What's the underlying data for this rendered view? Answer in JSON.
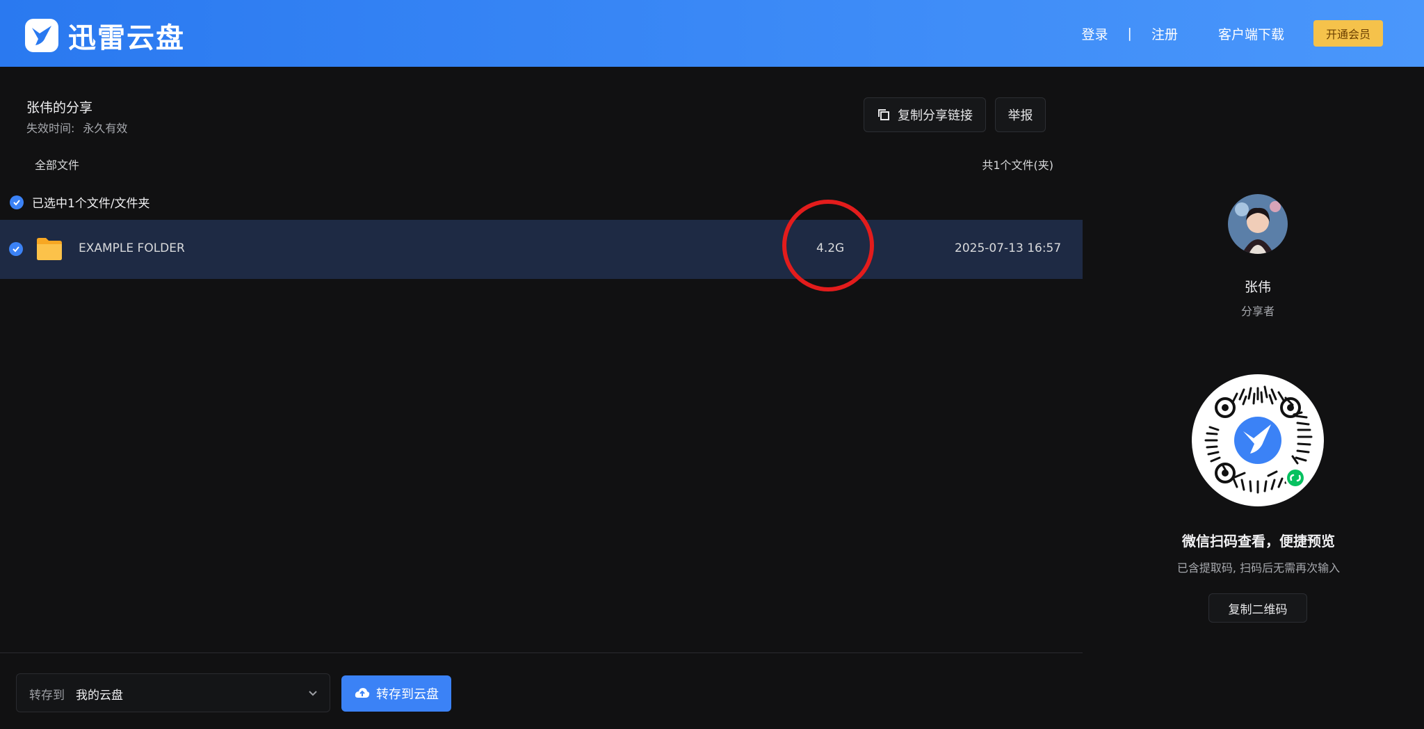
{
  "header": {
    "brand": "迅雷云盘",
    "login": "登录",
    "separator": "|",
    "register": "注册",
    "client_download": "客户端下载",
    "vip": "开通会员"
  },
  "share": {
    "title": "张伟的分享",
    "expire_label": "失效时间:",
    "expire_value": "永久有效",
    "copy_link_button": "复制分享链接",
    "report_button": "举报"
  },
  "file_list": {
    "all_files_label": "全部文件",
    "count_text": "共1个文件(夹)",
    "selected_text": "已选中1个文件/文件夹",
    "rows": [
      {
        "name": "EXAMPLE FOLDER",
        "size": "4.2G",
        "date": "2025-07-13 16:57",
        "selected": true
      }
    ]
  },
  "sharer": {
    "name": "张伟",
    "role": "分享者"
  },
  "qr": {
    "title": "微信扫码查看，便捷预览",
    "subtitle": "已含提取码, 扫码后无需再次输入",
    "copy_button": "复制二维码"
  },
  "bottom": {
    "save_to_label": "转存到",
    "save_to_value": "我的云盘",
    "save_button": "转存到云盘"
  },
  "colors": {
    "header_blue": "#3d8bf7",
    "accent_blue": "#3b82f6",
    "vip_gold": "#f5c24b",
    "annotation_red": "#e31c1c"
  }
}
